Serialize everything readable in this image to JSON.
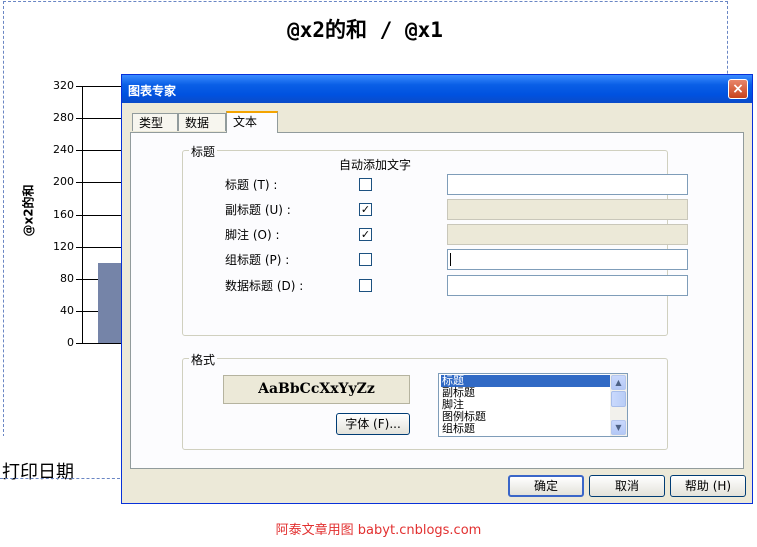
{
  "report": {
    "title": "@x2的和  / @x1",
    "print_date": "打印日期",
    "footer_credit": "阿泰文章用图  babyt.cnblogs.com"
  },
  "chart_data": {
    "type": "bar",
    "ylabel": "@x2的和",
    "ylim": [
      0,
      320
    ],
    "yticks": [
      "0",
      "40",
      "80",
      "120",
      "160",
      "200",
      "240",
      "280",
      "320"
    ],
    "values": [
      100
    ]
  },
  "dialog": {
    "title": "图表专家",
    "close_icon": "×",
    "tabs": [
      {
        "label": "类型",
        "active": false
      },
      {
        "label": "数据",
        "active": false
      },
      {
        "label": "文本",
        "active": true
      }
    ],
    "titles_group": {
      "legend": "标题",
      "auto_text_header": "自动添加文字",
      "rows": [
        {
          "label": "标题 (T) :",
          "checked": false,
          "field_enabled": true,
          "value": ""
        },
        {
          "label": "副标题 (U) :",
          "checked": true,
          "field_enabled": false,
          "value": ""
        },
        {
          "label": "脚注 (O) :",
          "checked": true,
          "field_enabled": false,
          "value": ""
        },
        {
          "label": "组标题 (P) :",
          "checked": false,
          "field_enabled": true,
          "value": ""
        },
        {
          "label": "数据标题 (D) :",
          "checked": false,
          "field_enabled": true,
          "value": ""
        }
      ]
    },
    "format_group": {
      "legend": "格式",
      "preview": "AaBbCcXxYyZz",
      "font_button": "字体 (F)...",
      "list_items": [
        "标题",
        "副标题",
        "脚注",
        "图例标题",
        "组标题"
      ],
      "selected_index": 0
    },
    "buttons": {
      "ok": "确定",
      "cancel": "取消",
      "help": "帮助 (H)"
    },
    "colors": {
      "titlebar": "#0a5fe6",
      "dialog_bg": "#ece9d8",
      "bar": "#7584a8",
      "credit": "#e23030"
    }
  }
}
